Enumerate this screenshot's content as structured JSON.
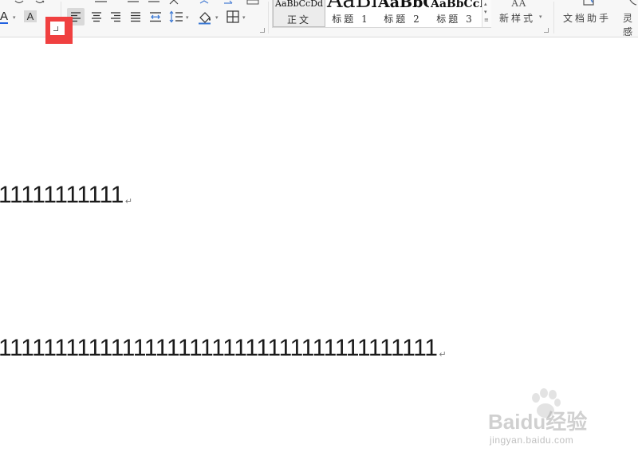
{
  "ribbon": {
    "style_gallery": {
      "styles": [
        {
          "preview": "AaBbCcDd",
          "name": "正文"
        },
        {
          "preview": "AaBl",
          "name": "标题 1"
        },
        {
          "preview": "AaBbC",
          "name": "标题 2"
        },
        {
          "preview": "AaBbCcI",
          "name": "标题 3"
        }
      ]
    },
    "new_style_label": "新样式",
    "doc_assistant_label": "文档助手",
    "cut_off_label": "灵感"
  },
  "document": {
    "line1": "11111111111",
    "line2": "111111111111111111111111111111111111111",
    "paragraph_mark": "↵"
  },
  "watermark": {
    "brand": "Baidu经验",
    "url": "jingyan.baidu.com"
  },
  "colors": {
    "highlight": "#f04040",
    "font_color_underline": "#2060e0",
    "ribbon_bg": "#f7f7f7"
  }
}
